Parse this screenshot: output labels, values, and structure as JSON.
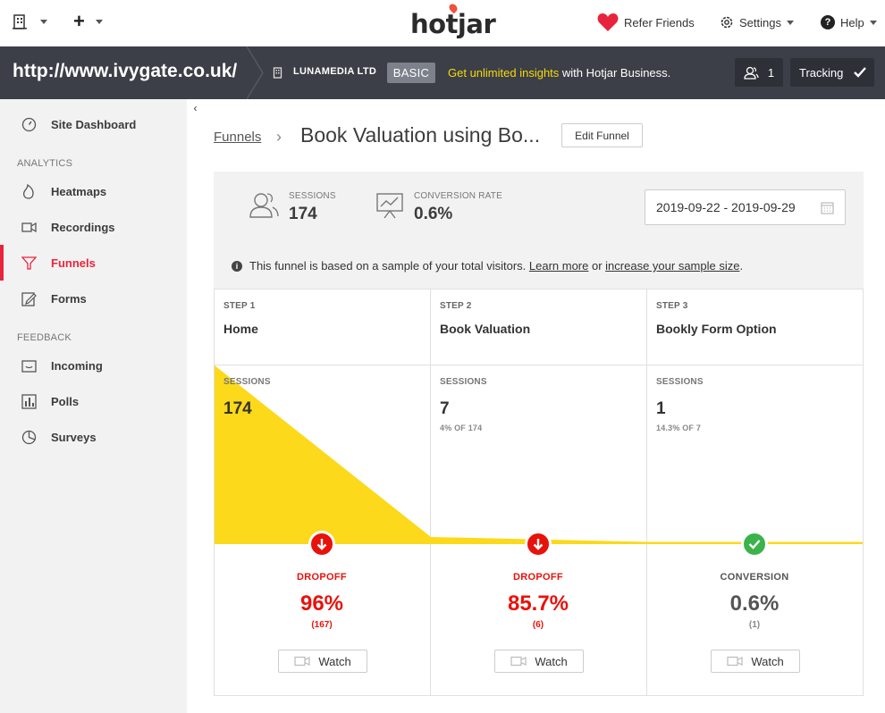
{
  "topbar": {
    "logo": "hotjar",
    "refer_friends": "Refer Friends",
    "settings": "Settings",
    "help": "Help"
  },
  "sitebar": {
    "site_url": "http://www.ivygate.co.uk/",
    "org_name": "LUNAMEDIA LTD",
    "plan_badge": "BASIC",
    "upsell_link": "Get unlimited insights",
    "upsell_text": " with Hotjar Business.",
    "user_count": "1",
    "tracking_label": "Tracking"
  },
  "sidebar": {
    "dashboard": "Site Dashboard",
    "analytics_heading": "ANALYTICS",
    "heatmaps": "Heatmaps",
    "recordings": "Recordings",
    "funnels": "Funnels",
    "forms": "Forms",
    "feedback_heading": "FEEDBACK",
    "incoming": "Incoming",
    "polls": "Polls",
    "surveys": "Surveys"
  },
  "header": {
    "breadcrumb": "Funnels",
    "title": "Book Valuation using Bo...",
    "edit_button": "Edit Funnel"
  },
  "summary": {
    "sessions_label": "SESSIONS",
    "sessions_value": "174",
    "conversion_label": "CONVERSION RATE",
    "conversion_value": "0.6%",
    "date_range": "2019-09-22 - 2019-09-29"
  },
  "info": {
    "text_before": "This funnel is based on a sample of your total visitors. ",
    "learn_more": "Learn more",
    "text_mid": " or ",
    "increase_link": "increase your sample size",
    "text_after": "."
  },
  "steps": [
    {
      "step": "STEP 1",
      "name": "Home",
      "sessions_label": "SESSIONS",
      "sessions": "174",
      "sub": "",
      "result_label": "DROPOFF",
      "result_value": "96%",
      "result_count": "(167)",
      "watch": "Watch"
    },
    {
      "step": "STEP 2",
      "name": "Book Valuation",
      "sessions_label": "SESSIONS",
      "sessions": "7",
      "sub": "4% OF 174",
      "result_label": "DROPOFF",
      "result_value": "85.7%",
      "result_count": "(6)",
      "watch": "Watch"
    },
    {
      "step": "STEP 3",
      "name": "Bookly Form Option",
      "sessions_label": "SESSIONS",
      "sessions": "1",
      "sub": "14.3% OF 7",
      "result_label": "CONVERSION",
      "result_value": "0.6%",
      "result_count": "(1)",
      "watch": "Watch"
    }
  ],
  "chart_data": {
    "type": "area",
    "categories": [
      "Home",
      "Book Valuation",
      "Bookly Form Option"
    ],
    "values": [
      174,
      7,
      1
    ]
  },
  "colors": {
    "accent": "#e8243c",
    "funnel_fill": "#fcd91b",
    "dropoff": "#e8120c",
    "conversion": "#3bb34a",
    "upsell_link": "#f5d90a"
  }
}
